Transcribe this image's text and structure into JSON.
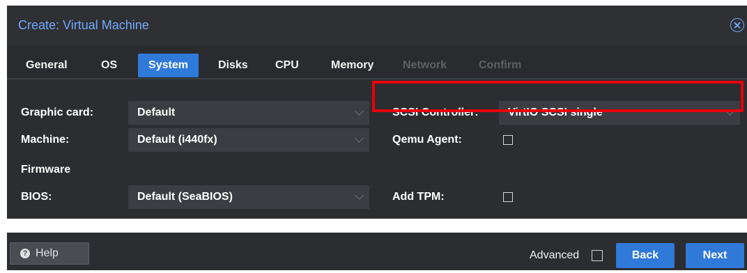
{
  "dialog": {
    "title": "Create: Virtual Machine",
    "close_icon": "close-circle-icon"
  },
  "tabs": [
    {
      "label": "General",
      "state": "normal"
    },
    {
      "label": "OS",
      "state": "normal"
    },
    {
      "label": "System",
      "state": "active"
    },
    {
      "label": "Disks",
      "state": "normal"
    },
    {
      "label": "CPU",
      "state": "normal"
    },
    {
      "label": "Memory",
      "state": "normal"
    },
    {
      "label": "Network",
      "state": "disabled"
    },
    {
      "label": "Confirm",
      "state": "disabled"
    }
  ],
  "form": {
    "graphic_card": {
      "label": "Graphic card:",
      "value": "Default"
    },
    "machine": {
      "label": "Machine:",
      "value": "Default (i440fx)"
    },
    "firmware_header": "Firmware",
    "bios": {
      "label": "BIOS:",
      "value": "Default (SeaBIOS)"
    },
    "scsi_controller": {
      "label": "SCSI Controller:",
      "value": "VirtIO SCSI single"
    },
    "qemu_agent": {
      "label": "Qemu Agent:",
      "checked": false
    },
    "add_tpm": {
      "label": "Add TPM:",
      "checked": false
    }
  },
  "footer": {
    "help_label": "Help",
    "help_icon": "question-circle-icon",
    "advanced_label": "Advanced",
    "advanced_checked": false,
    "back_label": "Back",
    "next_label": "Next"
  },
  "colors": {
    "accent": "#2f79d9",
    "title": "#6ea8ff",
    "dialog_bg": "#2b2d30",
    "field_bg": "#3b3d42",
    "highlight": "#e8000b"
  }
}
